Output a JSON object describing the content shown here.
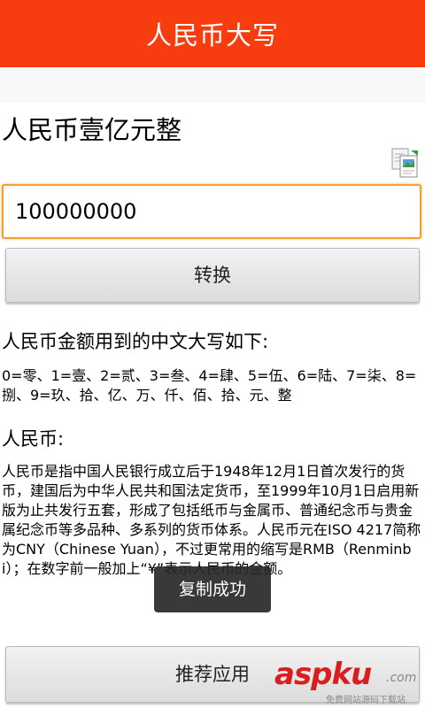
{
  "app": {
    "title": "人民币大写"
  },
  "result": {
    "text": "人民币壹亿元整"
  },
  "input": {
    "value": "100000000"
  },
  "buttons": {
    "convert": "转换",
    "recommend": "推荐应用"
  },
  "info": {
    "heading": "人民币金额用到的中文大写如下:",
    "digits": "0=零、1=壹、2=贰、3=叁、4=肆、5=伍、6=陆、7=柒、8=捌、9=玖、拾、亿、万、仟、佰、拾、元、整",
    "sub_heading": "人民币:",
    "description": "人民币是指中国人民银行成立后于1948年12月1日首次发行的货币，建国后为中华人民共和国法定货币，至1999年10月1日启用新版为止共发行五套，形成了包括纸币与金属币、普通纪念币与贵金属纪念币等多品种、多系列的货币体系。人民币元在ISO 4217简称为CNY（Chinese Yuan），不过更常用的缩写是RMB（Renminbi）；在数字前一般加上“¥”表示人民币的金额。"
  },
  "toast": {
    "text": "复制成功"
  },
  "watermark": {
    "brand": "aspku",
    "dotcom": ".com",
    "sub": "免费网站源码下载站"
  },
  "colors": {
    "titlebar": "#f73c10",
    "input_focus_border": "#f0a030",
    "watermark": "#d81e1e"
  },
  "icons": {
    "copy": "copy-documents-icon"
  }
}
